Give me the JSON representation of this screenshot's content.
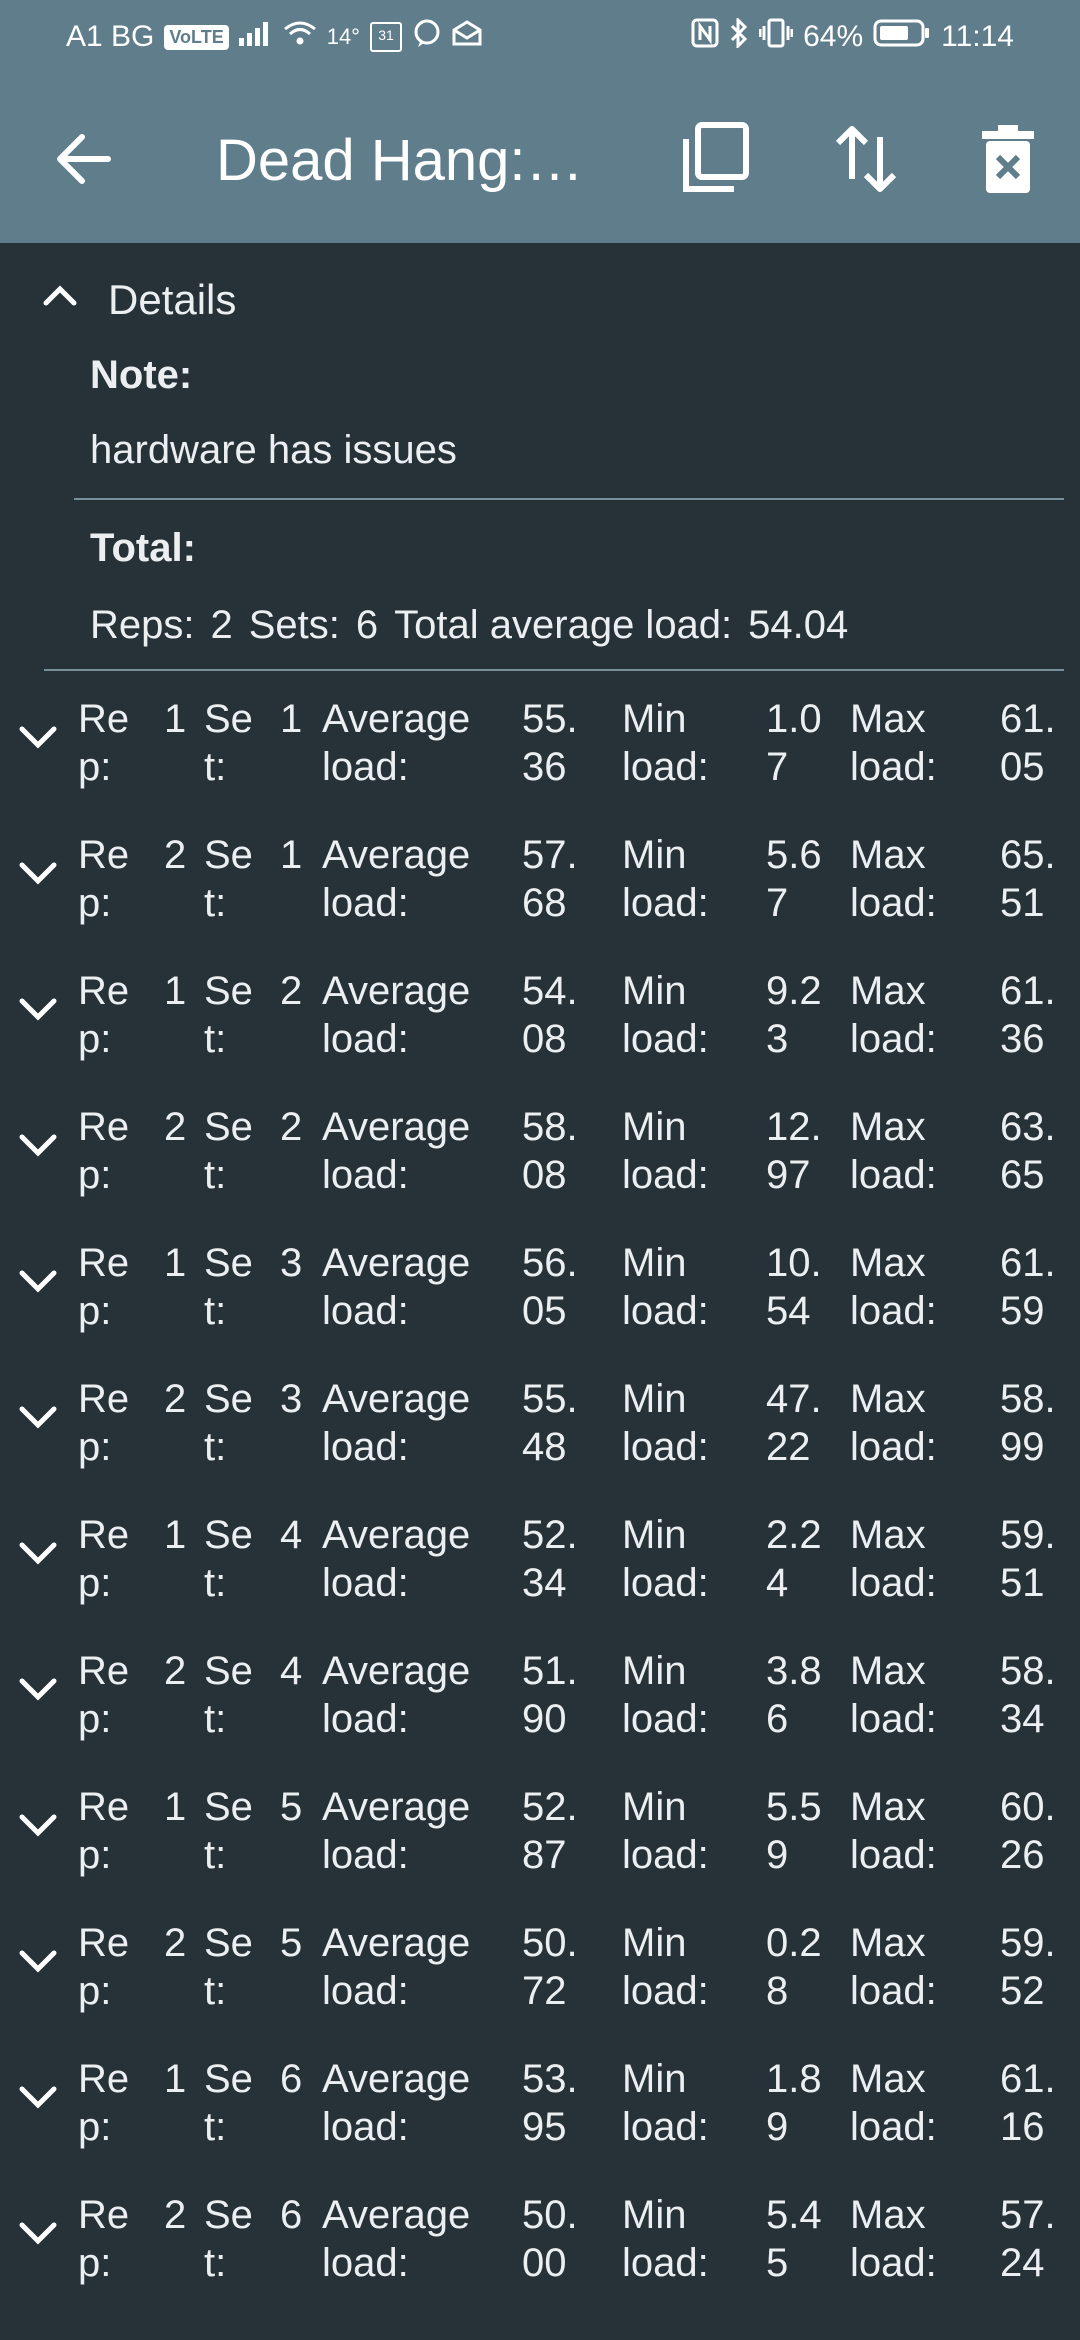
{
  "status_bar": {
    "carrier": "A1 BG",
    "volte": "VoLTE",
    "temp": "14°",
    "cal_day": "31",
    "battery": "64%",
    "time": "11:14"
  },
  "toolbar": {
    "title": "Dead Hang:…",
    "icons": [
      "back-arrow-icon",
      "copy-icon",
      "sort-icon",
      "delete-icon"
    ]
  },
  "details": {
    "label": "Details",
    "note_label": "Note:",
    "note_value": "hardware has issues",
    "total_label": "Total:",
    "reps_label": "Reps:",
    "reps_value": "2",
    "sets_label": "Sets:",
    "sets_value": "6",
    "avg_label": "Total average load:",
    "avg_value": "54.04"
  },
  "row_labels": {
    "rep_a": "Re",
    "rep_b": "p:",
    "set_a": "Se",
    "set_b": "t:",
    "avg_a": "Average",
    "avg_b": "load:",
    "min_a": "Min",
    "min_b": "load:",
    "max_a": "Max",
    "max_b": "load:"
  },
  "rows": [
    {
      "rep": "1",
      "set": "1",
      "avg": [
        "55.",
        "36"
      ],
      "min": [
        "1.0",
        "7"
      ],
      "max": [
        "61.",
        "05"
      ]
    },
    {
      "rep": "2",
      "set": "1",
      "avg": [
        "57.",
        "68"
      ],
      "min": [
        "5.6",
        "7"
      ],
      "max": [
        "65.",
        "51"
      ]
    },
    {
      "rep": "1",
      "set": "2",
      "avg": [
        "54.",
        "08"
      ],
      "min": [
        "9.2",
        "3"
      ],
      "max": [
        "61.",
        "36"
      ]
    },
    {
      "rep": "2",
      "set": "2",
      "avg": [
        "58.",
        "08"
      ],
      "min": [
        "12.",
        "97"
      ],
      "max": [
        "63.",
        "65"
      ]
    },
    {
      "rep": "1",
      "set": "3",
      "avg": [
        "56.",
        "05"
      ],
      "min": [
        "10.",
        "54"
      ],
      "max": [
        "61.",
        "59"
      ]
    },
    {
      "rep": "2",
      "set": "3",
      "avg": [
        "55.",
        "48"
      ],
      "min": [
        "47.",
        "22"
      ],
      "max": [
        "58.",
        "99"
      ]
    },
    {
      "rep": "1",
      "set": "4",
      "avg": [
        "52.",
        "34"
      ],
      "min": [
        "2.2",
        "4"
      ],
      "max": [
        "59.",
        "51"
      ]
    },
    {
      "rep": "2",
      "set": "4",
      "avg": [
        "51.",
        "90"
      ],
      "min": [
        "3.8",
        "6"
      ],
      "max": [
        "58.",
        "34"
      ]
    },
    {
      "rep": "1",
      "set": "5",
      "avg": [
        "52.",
        "87"
      ],
      "min": [
        "5.5",
        "9"
      ],
      "max": [
        "60.",
        "26"
      ]
    },
    {
      "rep": "2",
      "set": "5",
      "avg": [
        "50.",
        "72"
      ],
      "min": [
        "0.2",
        "8"
      ],
      "max": [
        "59.",
        "52"
      ]
    },
    {
      "rep": "1",
      "set": "6",
      "avg": [
        "53.",
        "95"
      ],
      "min": [
        "1.8",
        "9"
      ],
      "max": [
        "61.",
        "16"
      ]
    },
    {
      "rep": "2",
      "set": "6",
      "avg": [
        "50.",
        "00"
      ],
      "min": [
        "5.4",
        "5"
      ],
      "max": [
        "57.",
        "24"
      ]
    }
  ]
}
